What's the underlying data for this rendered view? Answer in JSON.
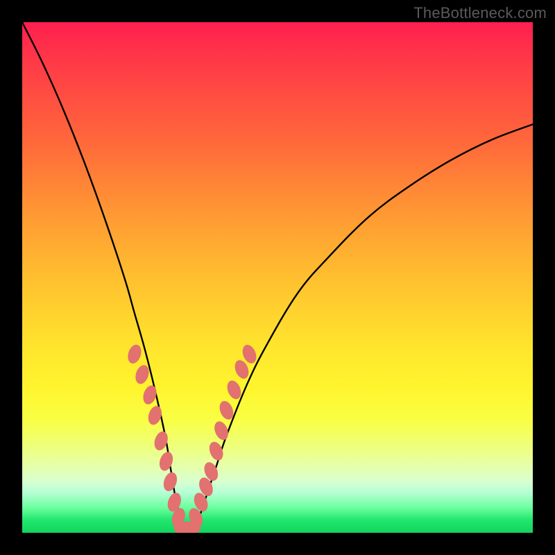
{
  "watermark": "TheBottleneck.com",
  "colors": {
    "background": "#000000",
    "curve": "#000000",
    "marker": "#e2716f"
  },
  "chart_data": {
    "type": "line",
    "title": "",
    "xlabel": "",
    "ylabel": "",
    "xlim": [
      0,
      100
    ],
    "ylim": [
      0,
      100
    ],
    "grid": false,
    "legend": false,
    "description": "V-shaped bottleneck curve; sharp dip to ~0 near x≈32, right arm rises slowly; salmon markers highlight the lower portion of both arms near the trough.",
    "series": [
      {
        "name": "bottleneck-curve",
        "x": [
          0,
          4,
          8,
          12,
          16,
          20,
          22,
          24,
          26,
          28,
          29,
          30,
          31,
          32,
          33,
          34,
          35,
          36,
          38,
          40,
          44,
          48,
          54,
          60,
          68,
          76,
          84,
          92,
          100
        ],
        "y": [
          100,
          92,
          83,
          73,
          62,
          50,
          43,
          36,
          28,
          19,
          13,
          7,
          3,
          1,
          1,
          2,
          4,
          7,
          13,
          19,
          29,
          37,
          47,
          54,
          62,
          68,
          73,
          77,
          80
        ]
      }
    ],
    "markers": {
      "left_arm": {
        "x": [
          22.0,
          23.5,
          25.0,
          26.0,
          27.2,
          28.2,
          29.0,
          29.8,
          30.6
        ],
        "y": [
          35,
          31,
          27,
          23,
          18,
          14,
          10,
          6,
          3
        ]
      },
      "trough": {
        "x": [
          31.3,
          32.3,
          33.3
        ],
        "y": [
          1,
          1,
          1
        ]
      },
      "right_arm": {
        "x": [
          34.0,
          35.0,
          36.0,
          37.0,
          38.0,
          39.0,
          40.0,
          41.5,
          43.0,
          44.5
        ],
        "y": [
          3,
          6,
          9,
          12,
          16,
          20,
          24,
          28,
          32,
          35
        ]
      }
    }
  }
}
